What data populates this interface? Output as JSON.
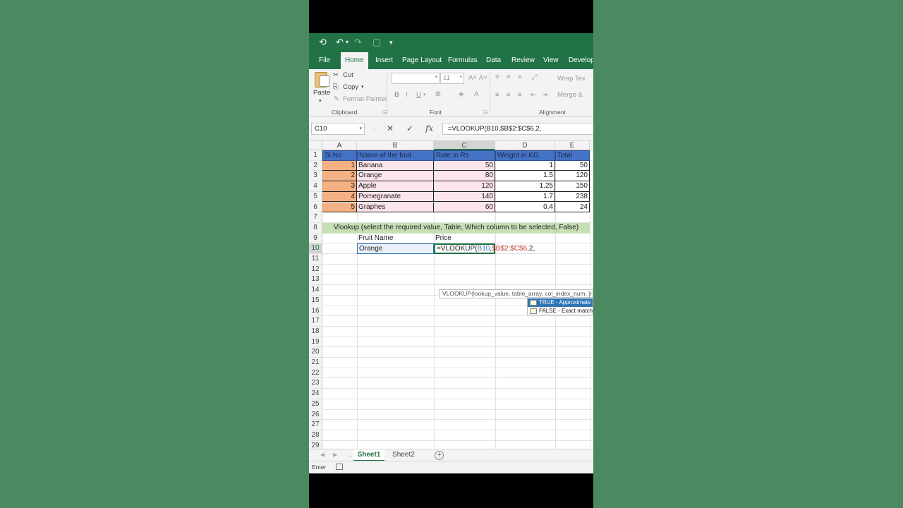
{
  "quick_access": {
    "save_icon": "autosave-icon",
    "undo_icon": "undo-icon",
    "redo_icon": "redo-icon",
    "customize_icon": "customize-icon"
  },
  "tabs": [
    "File",
    "Home",
    "Insert",
    "Page Layout",
    "Formulas",
    "Data",
    "Review",
    "View",
    "Develop"
  ],
  "active_tab": "Home",
  "ribbon": {
    "paste": "Paste",
    "cut": "Cut",
    "copy": "Copy",
    "format_painter": "Format Painter",
    "font_size": "11",
    "wrap_text": "Wrap Tex",
    "merge": "Merge &",
    "groups": {
      "clipboard": "Clipboard",
      "font": "Font",
      "alignment": "Alignment"
    }
  },
  "formula_bar": {
    "name_box": "C10",
    "formula": "=VLOOKUP(B10,$B$2:$C$6,2,"
  },
  "columns": [
    "A",
    "B",
    "C",
    "D",
    "E"
  ],
  "selected_column": "C",
  "rows": [
    "1",
    "2",
    "3",
    "4",
    "5",
    "6",
    "7",
    "8",
    "9",
    "10",
    "11",
    "12",
    "13",
    "14",
    "15",
    "16",
    "17",
    "18",
    "19",
    "20",
    "21",
    "22",
    "23",
    "24",
    "25",
    "26",
    "27",
    "28",
    "29"
  ],
  "table": {
    "headers": [
      "Sl.No",
      "Name of the fruit",
      "Rate in Rs",
      "Weight in KG",
      "Total"
    ],
    "rows": [
      [
        "1",
        "Banana",
        "50",
        "1",
        "50"
      ],
      [
        "2",
        "Orange",
        "80",
        "1.5",
        "120"
      ],
      [
        "3",
        "Apple",
        "120",
        "1.25",
        "150"
      ],
      [
        "4",
        "Pomegranate",
        "140",
        "1.7",
        "238"
      ],
      [
        "5",
        "Graphes",
        "60",
        "0.4",
        "24"
      ]
    ]
  },
  "banner": "Vlookup (select the required value, Table, Which column to be selected, False)",
  "lookup": {
    "fruit_label": "Fruit Name",
    "price_label": "Price",
    "fruit_value": "Orange",
    "formula_prefix": "=VLOOKUP(",
    "formula_arg1": "B10",
    "formula_comma1": ",",
    "formula_arg2": "$B$2:$C$6",
    "formula_tail": ",2,"
  },
  "tooltip": "VLOOKUP(lookup_value, table_array, col_index_num, [range_lookup])",
  "autocomplete": [
    "TRUE - Approximate match",
    "FALSE - Exact match"
  ],
  "sheets": [
    "Sheet1",
    "Sheet2"
  ],
  "active_sheet": "Sheet1",
  "status": "Enter",
  "colors": {
    "excel_green": "#217346",
    "header_blue": "#4472c4",
    "orange": "#f4b183",
    "pink": "#fce4ec",
    "band_green": "#c6e0b4",
    "background": "#4b8a60"
  }
}
